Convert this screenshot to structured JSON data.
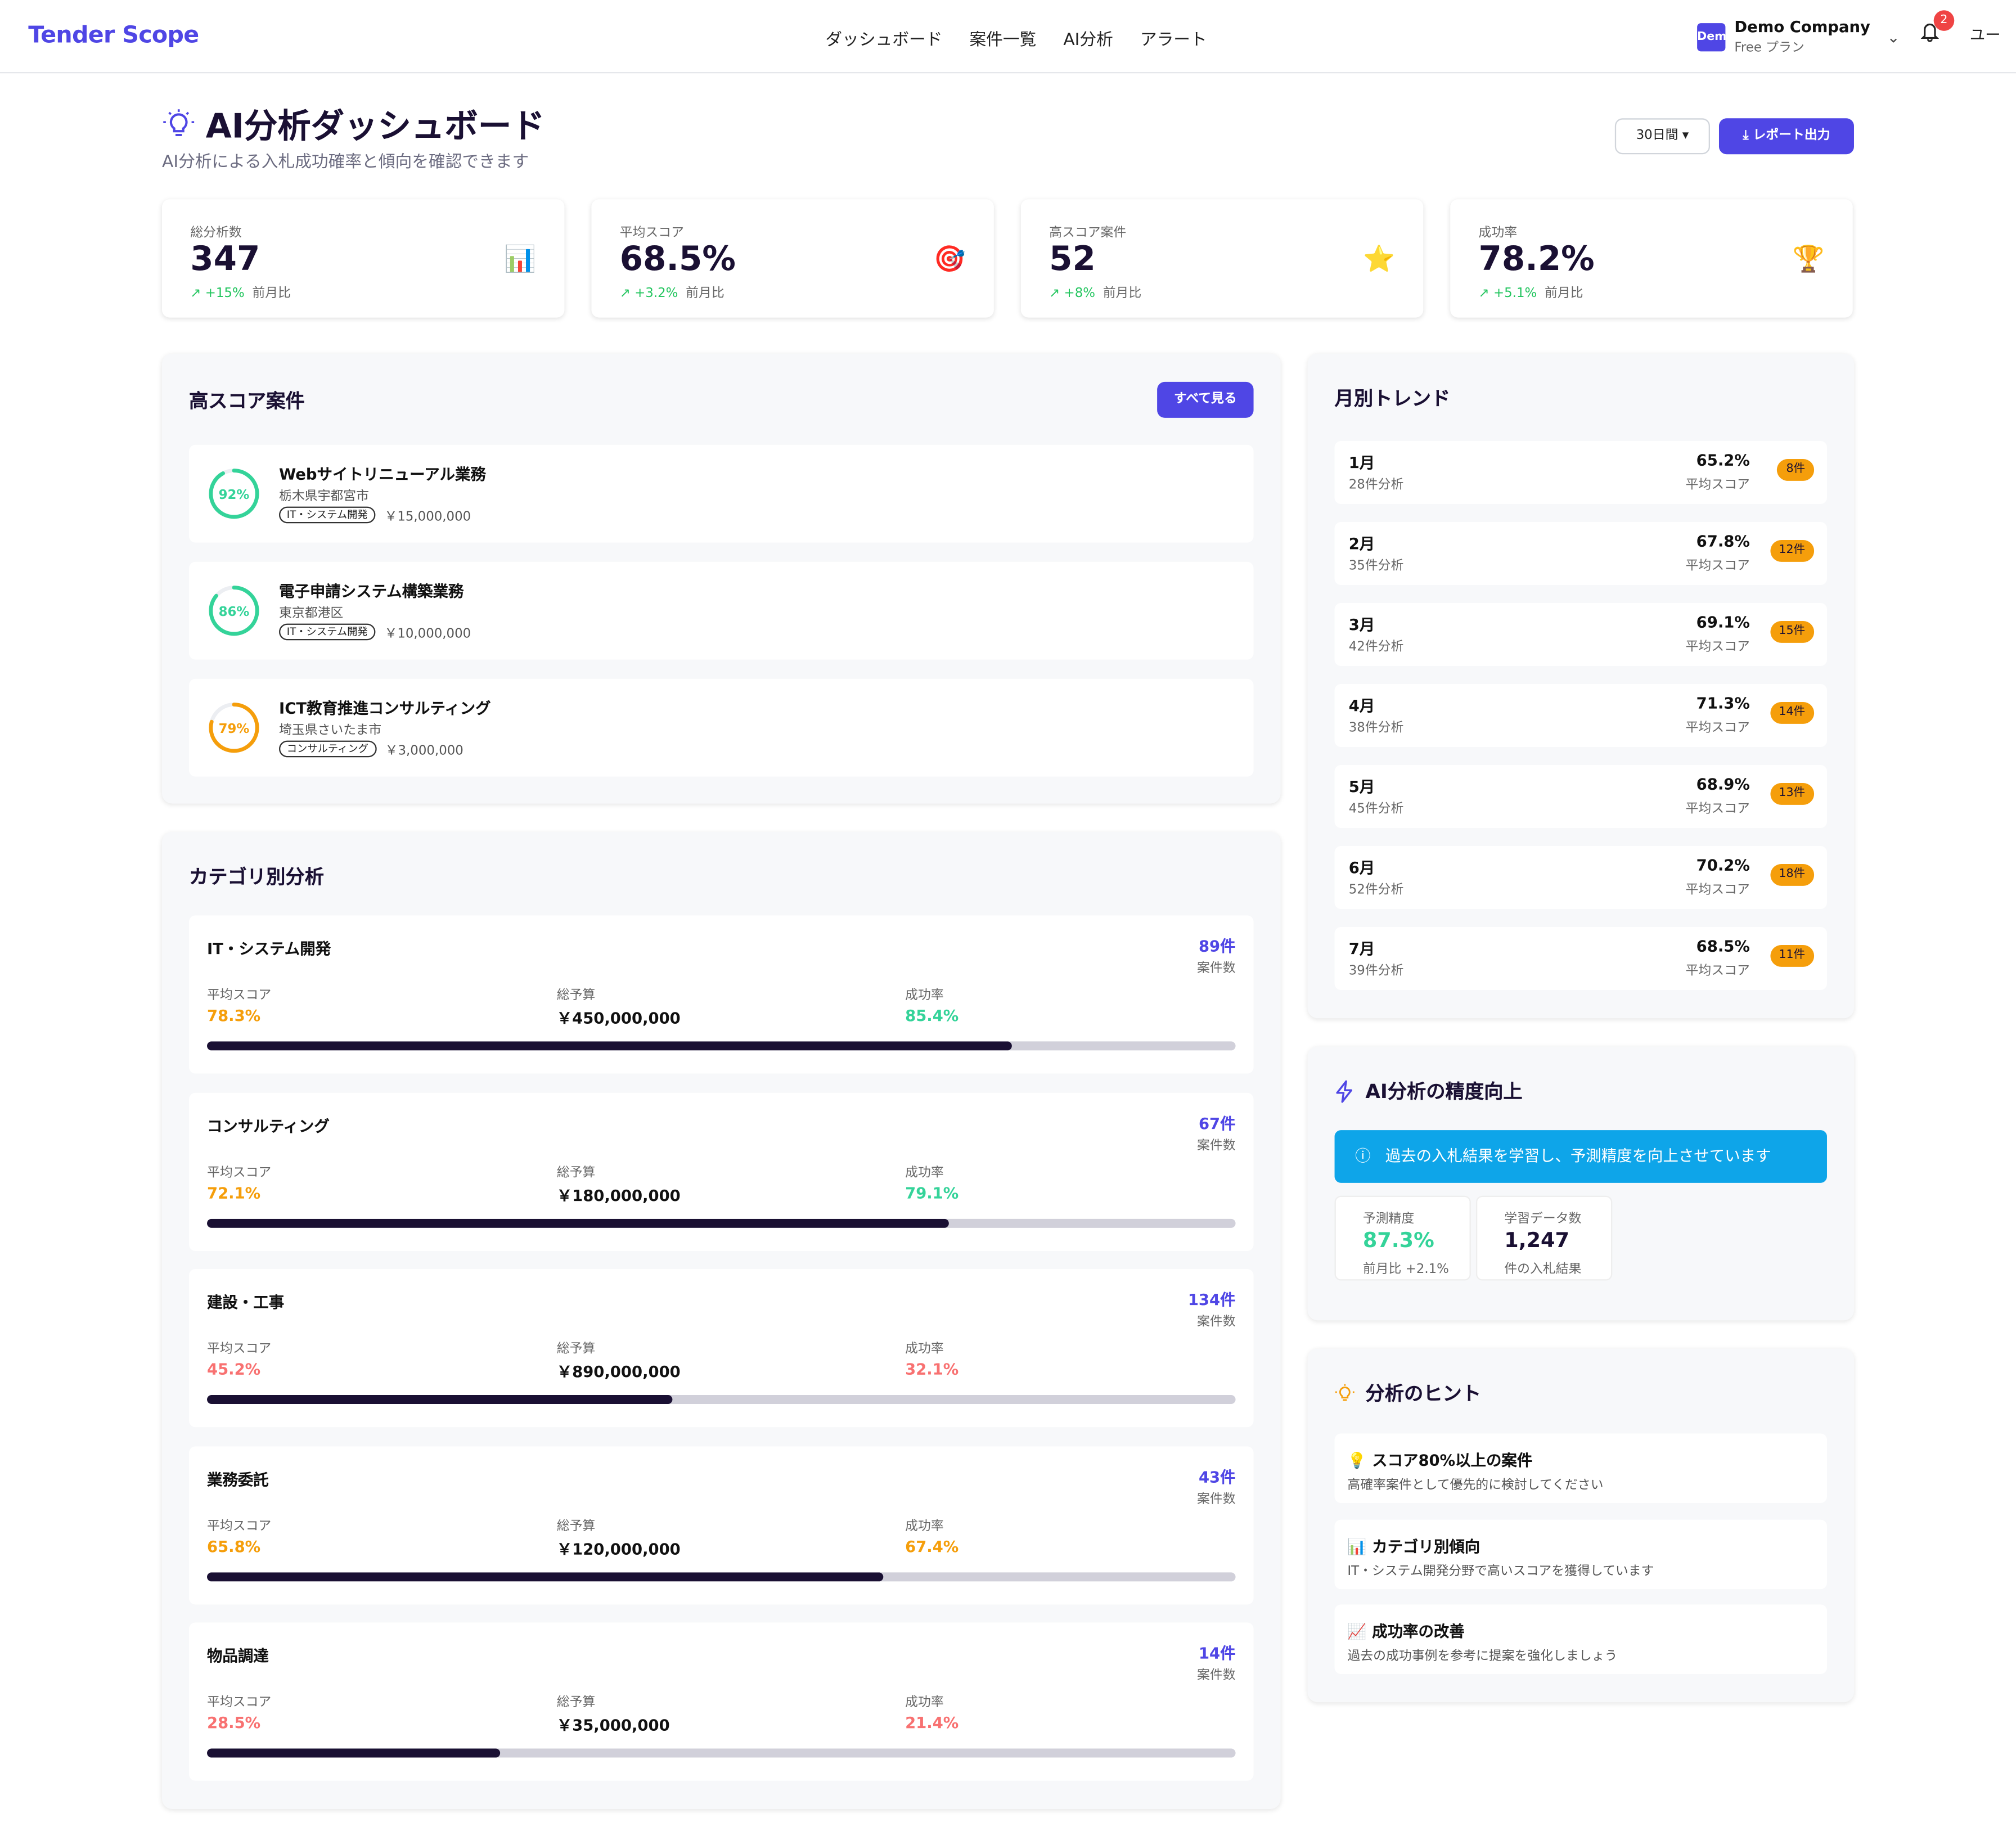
{
  "header": {
    "brand": "Tender Scope",
    "nav": [
      "ダッシュボード",
      "案件一覧",
      "AI分析",
      "アラート"
    ],
    "company_logo": "Dem",
    "company_name": "Demo Company",
    "plan": "Free プラン",
    "notifications": "2",
    "user": "ユー"
  },
  "page": {
    "title": "AI分析ダッシュボード",
    "subtitle": "AI分析による入札成功確率と傾向を確認できます",
    "range": "30日間 ▾",
    "report": "レポート出力"
  },
  "stats": [
    {
      "label": "総分析数",
      "value": "347",
      "delta": "+15%",
      "compare": "前月比",
      "icon": "chart-icon"
    },
    {
      "label": "平均スコア",
      "value": "68.5%",
      "delta": "+3.2%",
      "compare": "前月比",
      "icon": "target-icon"
    },
    {
      "label": "高スコア案件",
      "value": "52",
      "delta": "+8%",
      "compare": "前月比",
      "icon": "star-icon"
    },
    {
      "label": "成功率",
      "value": "78.2%",
      "delta": "+5.1%",
      "compare": "前月比",
      "icon": "trophy-icon"
    }
  ],
  "high_score": {
    "title": "高スコア案件",
    "see_all": "すべて見る",
    "items": [
      {
        "score": 92,
        "score_label": "92%",
        "color": "#34d399",
        "title": "Webサイトリニューアル業務",
        "location": "栃木県宇都宮市",
        "tag": "IT・システム開発",
        "budget": "￥15,000,000"
      },
      {
        "score": 86,
        "score_label": "86%",
        "color": "#34d399",
        "title": "電子申請システム構築業務",
        "location": "東京都港区",
        "tag": "IT・システム開発",
        "budget": "￥10,000,000"
      },
      {
        "score": 79,
        "score_label": "79%",
        "color": "#f59e0b",
        "title": "ICT教育推進コンサルティング",
        "location": "埼玉県さいたま市",
        "tag": "コンサルティング",
        "budget": "￥3,000,000"
      }
    ]
  },
  "category": {
    "title": "カテゴリ別分析",
    "labels": {
      "avg": "平均スコア",
      "budget": "総予算",
      "rate": "成功率",
      "count_sub": "案件数"
    },
    "items": [
      {
        "name": "IT・システム開発",
        "count": "89件",
        "avg": "78.3%",
        "avg_color": "#f59e0b",
        "budget": "￥450,000,000",
        "rate": "85.4%",
        "rate_color": "#34d399",
        "progress": 0.783
      },
      {
        "name": "コンサルティング",
        "count": "67件",
        "avg": "72.1%",
        "avg_color": "#f59e0b",
        "budget": "￥180,000,000",
        "rate": "79.1%",
        "rate_color": "#34d399",
        "progress": 0.721
      },
      {
        "name": "建設・工事",
        "count": "134件",
        "avg": "45.2%",
        "avg_color": "#f87171",
        "budget": "￥890,000,000",
        "rate": "32.1%",
        "rate_color": "#f87171",
        "progress": 0.452
      },
      {
        "name": "業務委託",
        "count": "43件",
        "avg": "65.8%",
        "avg_color": "#f59e0b",
        "budget": "￥120,000,000",
        "rate": "67.4%",
        "rate_color": "#f59e0b",
        "progress": 0.658
      },
      {
        "name": "物品調達",
        "count": "14件",
        "avg": "28.5%",
        "avg_color": "#f87171",
        "budget": "￥35,000,000",
        "rate": "21.4%",
        "rate_color": "#f87171",
        "progress": 0.285
      }
    ]
  },
  "trend": {
    "title": "月別トレンド",
    "score_label": "平均スコア",
    "months": [
      {
        "month": "1月",
        "count": "28件分析",
        "score": "65.2%",
        "badge": "8件"
      },
      {
        "month": "2月",
        "count": "35件分析",
        "score": "67.8%",
        "badge": "12件"
      },
      {
        "month": "3月",
        "count": "42件分析",
        "score": "69.1%",
        "badge": "15件"
      },
      {
        "month": "4月",
        "count": "38件分析",
        "score": "71.3%",
        "badge": "14件"
      },
      {
        "month": "5月",
        "count": "45件分析",
        "score": "68.9%",
        "badge": "13件"
      },
      {
        "month": "6月",
        "count": "52件分析",
        "score": "70.2%",
        "badge": "18件"
      },
      {
        "month": "7月",
        "count": "39件分析",
        "score": "68.5%",
        "badge": "11件"
      }
    ]
  },
  "accuracy": {
    "title": "AI分析の精度向上",
    "info": "過去の入札結果を学習し、予測精度を向上させています",
    "precision_label": "予測精度",
    "precision_value": "87.3%",
    "precision_sub": "前月比 +2.1%",
    "data_label": "学習データ数",
    "data_value": "1,247",
    "data_sub": "件の入札結果"
  },
  "tips": {
    "title": "分析のヒント",
    "items": [
      {
        "icon": "💡",
        "title": "スコア80%以上の案件",
        "desc": "高確率案件として優先的に検討してください"
      },
      {
        "icon": "📊",
        "title": "カテゴリ別傾向",
        "desc": "IT・システム開発分野で高いスコアを獲得しています"
      },
      {
        "icon": "📈",
        "title": "成功率の改善",
        "desc": "過去の成功事例を参考に提案を強化しましょう"
      }
    ]
  },
  "colors": {
    "accent": "#4f46e5",
    "info": "#0ea5e9",
    "good": "#34d399",
    "warn": "#f59e0b",
    "bad": "#f87171"
  }
}
